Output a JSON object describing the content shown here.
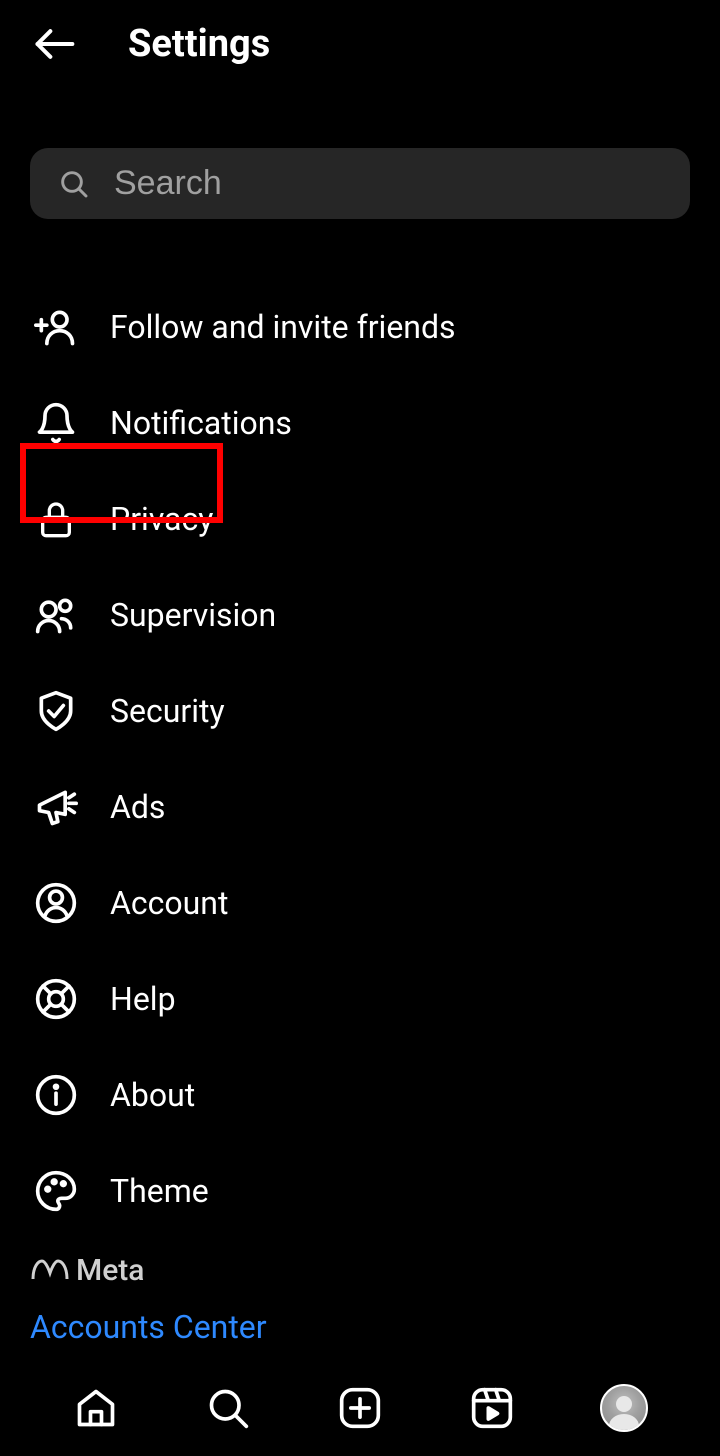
{
  "header": {
    "title": "Settings"
  },
  "search": {
    "placeholder": "Search"
  },
  "menu": {
    "items": [
      {
        "id": "follow-invite",
        "label": "Follow and invite friends"
      },
      {
        "id": "notifications",
        "label": "Notifications"
      },
      {
        "id": "privacy",
        "label": "Privacy"
      },
      {
        "id": "supervision",
        "label": "Supervision"
      },
      {
        "id": "security",
        "label": "Security"
      },
      {
        "id": "ads",
        "label": "Ads"
      },
      {
        "id": "account",
        "label": "Account"
      },
      {
        "id": "help",
        "label": "Help"
      },
      {
        "id": "about",
        "label": "About"
      },
      {
        "id": "theme",
        "label": "Theme"
      }
    ]
  },
  "footer": {
    "brand": "Meta",
    "accounts_center": "Accounts Center"
  },
  "highlighted_item": "privacy"
}
